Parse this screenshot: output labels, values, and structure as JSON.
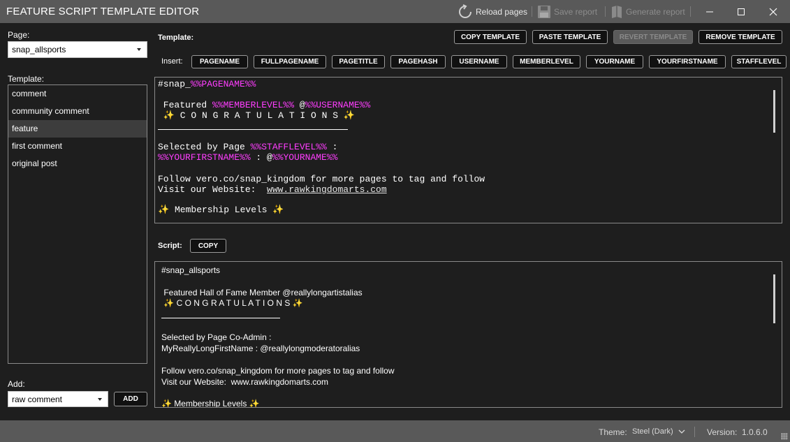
{
  "app": {
    "title": "FEATURE SCRIPT TEMPLATE EDITOR"
  },
  "toolbar": {
    "reload_label": "Reload pages",
    "save_report_label": "Save report",
    "generate_report_label": "Generate report"
  },
  "left": {
    "page_label": "Page:",
    "page_value": "snap_allsports",
    "template_label": "Template:",
    "templates": [
      {
        "label": "comment"
      },
      {
        "label": "community comment"
      },
      {
        "label": "feature",
        "selected": true
      },
      {
        "label": "first comment"
      },
      {
        "label": "original post"
      }
    ],
    "add_label": "Add:",
    "add_value": "raw comment",
    "add_button": "ADD"
  },
  "template_section": {
    "label": "Template:",
    "copy_button": "COPY TEMPLATE",
    "paste_button": "PASTE TEMPLATE",
    "revert_button": "REVERT TEMPLATE",
    "remove_button": "REMOVE TEMPLATE",
    "insert_label": "Insert:",
    "insert_buttons": [
      "PAGENAME",
      "FULLPAGENAME",
      "PAGETITLE",
      "PAGEHASH",
      "USERNAME",
      "MEMBERLEVEL",
      "YOURNAME",
      "YOURFIRSTNAME",
      "STAFFLEVEL"
    ]
  },
  "template_text": {
    "l1a": "#snap_",
    "l1v": "%%PAGENAME%%",
    "l2a": " Featured ",
    "l2v1": "%%MEMBERLEVEL%%",
    "l2b": " @",
    "l2v2": "%%USERNAME%%",
    "l3": " ✨ C O N G R A T U L A T I O N S ✨",
    "l4a": "Selected by Page ",
    "l4v": "%%STAFFLEVEL%%",
    "l4b": " :",
    "l5v1": "%%YOURFIRSTNAME%%",
    "l5a": " : @",
    "l5v2": "%%YOURNAME%%",
    "l6": "Follow vero.co/snap_kingdom for more pages to tag and follow",
    "l7a": "Visit our Website:  ",
    "l7link": "www.rawkingdomarts.com",
    "l8": "✨ Membership Levels ✨"
  },
  "script_section": {
    "label": "Script:",
    "copy_button": "COPY"
  },
  "script_text": {
    "l1": "#snap_allsports",
    "l2": " Featured Hall of Fame Member @reallylongartistalias",
    "l3": " ✨ C O N G R A T U L A T I O N S ✨",
    "l4": "Selected by Page Co-Admin :",
    "l5": "MyReallyLongFirstName : @reallylongmoderatoralias",
    "l6": "Follow vero.co/snap_kingdom for more pages to tag and follow",
    "l7": "Visit our Website:  www.rawkingdomarts.com",
    "l8": "✨ Membership Levels ✨"
  },
  "status": {
    "theme_label": "Theme:",
    "theme_value": "Steel (Dark)",
    "version_label": "Version:",
    "version_value": "1.0.6.0"
  },
  "colors": {
    "variable": "#ff3dff",
    "titlebar": "#595959",
    "background": "#1e1e1e"
  }
}
